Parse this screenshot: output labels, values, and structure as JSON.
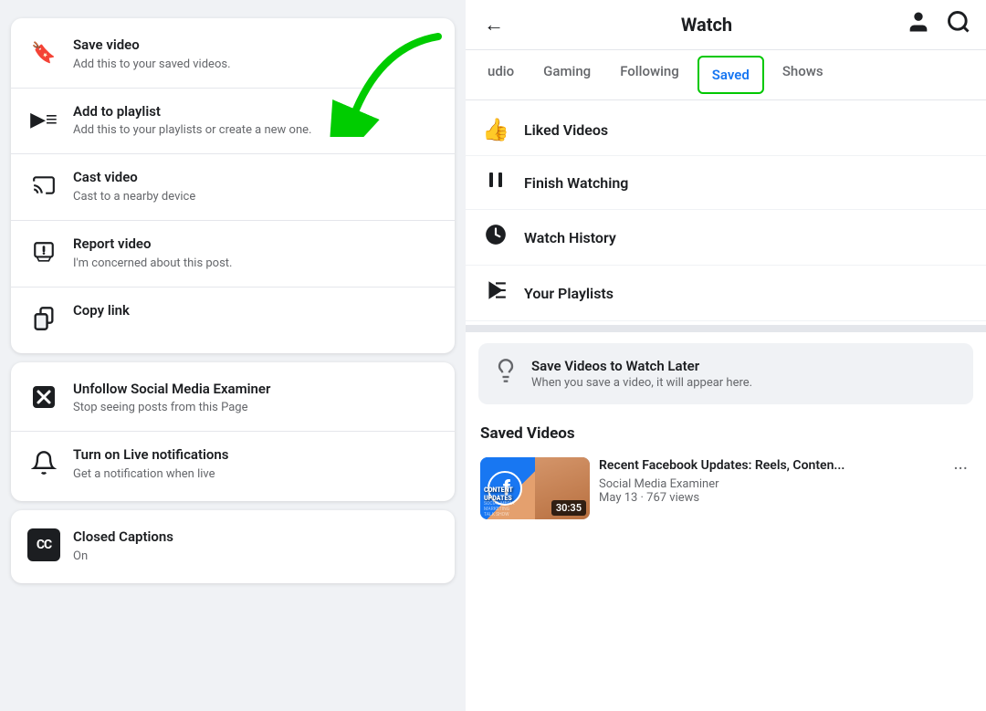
{
  "left": {
    "menu1": [
      {
        "icon": "🔖",
        "title": "Save video",
        "subtitle": "Add this to your saved videos.",
        "name": "save-video"
      },
      {
        "icon": "▶≡",
        "title": "Add to playlist",
        "subtitle": "Add this to your playlists or create a new one.",
        "name": "add-to-playlist"
      },
      {
        "icon": "⬜",
        "title": "Cast video",
        "subtitle": "Cast to a nearby device",
        "name": "cast-video"
      },
      {
        "icon": "❗",
        "title": "Report video",
        "subtitle": "I'm concerned about this post.",
        "name": "report-video"
      },
      {
        "icon": "📋",
        "title": "Copy link",
        "subtitle": "",
        "name": "copy-link"
      }
    ],
    "menu2": [
      {
        "icon": "✖",
        "title": "Unfollow Social Media Examiner",
        "subtitle": "Stop seeing posts from this Page",
        "name": "unfollow"
      },
      {
        "icon": "🔔",
        "title": "Turn on Live notifications",
        "subtitle": "Get a notification when live",
        "name": "live-notifications"
      }
    ],
    "menu3": [
      {
        "icon": "CC",
        "title": "Closed Captions",
        "subtitle": "On",
        "name": "closed-captions"
      }
    ]
  },
  "right": {
    "header": {
      "title": "Watch",
      "back_icon": "←",
      "person_icon": "👤",
      "search_icon": "🔍"
    },
    "tabs": [
      {
        "label": "udio",
        "active": false
      },
      {
        "label": "Gaming",
        "active": false
      },
      {
        "label": "Following",
        "active": false
      },
      {
        "label": "Saved",
        "active": true
      },
      {
        "label": "Shows",
        "active": false
      }
    ],
    "menu_items": [
      {
        "icon": "👍",
        "label": "Liked Videos"
      },
      {
        "icon": "⏸",
        "label": "Finish Watching"
      },
      {
        "icon": "🕐",
        "label": "Watch History"
      },
      {
        "icon": "▶≡",
        "label": "Your Playlists"
      }
    ],
    "save_prompt": {
      "icon": "💡",
      "title": "Save Videos to Watch Later",
      "subtitle": "When you save a video, it will appear here."
    },
    "saved_videos_label": "Saved Videos",
    "video": {
      "title": "Recent Facebook Updates: Reels, Conten...",
      "channel": "Social Media Examiner",
      "meta": "May 13 · 767 views",
      "duration": "30:35",
      "thumb_text": "CONTENT\nUPDATES"
    }
  }
}
